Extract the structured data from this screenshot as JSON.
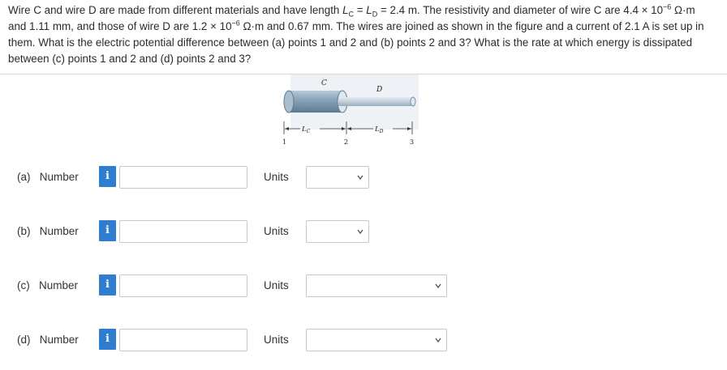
{
  "question": {
    "p1": "Wire C and wire D are made from different materials and have length ",
    "lc_L": "L",
    "lc_sub": "C",
    "eq1": " = ",
    "ld_L": "L",
    "ld_sub": "D",
    "p2": " = 2.4 m. The resistivity and diameter of wire C are 4.4 × 10",
    "exp1": "−6",
    "p3": " Ω·m and 1.11 mm, and those of wire D are 1.2 × 10",
    "exp2": "−6",
    "p4": " Ω·m and 0.67 mm. The wires are joined as shown in the figure and a current of 2.1 A is set up in them. What is the electric potential difference between (a) points 1 and 2 and (b) points 2 and 3? What is the rate at which energy is dissipated between (c) points 1 and 2 and (d) points 2 and 3?"
  },
  "figure": {
    "label_c": "C",
    "label_d": "D",
    "dim_lc": "L",
    "dim_lc_sub": "C",
    "dim_ld": "L",
    "dim_ld_sub": "D",
    "point1": "1",
    "point2": "2",
    "point3": "3"
  },
  "rows": [
    {
      "label": "(a)   Number",
      "info": "i",
      "value": "",
      "units_label": "Units",
      "units_value": ""
    },
    {
      "label": "(b)   Number",
      "info": "i",
      "value": "",
      "units_label": "Units",
      "units_value": ""
    },
    {
      "label": "(c)   Number",
      "info": "i",
      "value": "",
      "units_label": "Units",
      "units_value": ""
    },
    {
      "label": "(d)   Number",
      "info": "i",
      "value": "",
      "units_label": "Units",
      "units_value": ""
    }
  ],
  "colors": {
    "info_button": "#2f7dd1",
    "wire_c": "#8fa9bd",
    "wire_d": "#c9d6e0"
  }
}
